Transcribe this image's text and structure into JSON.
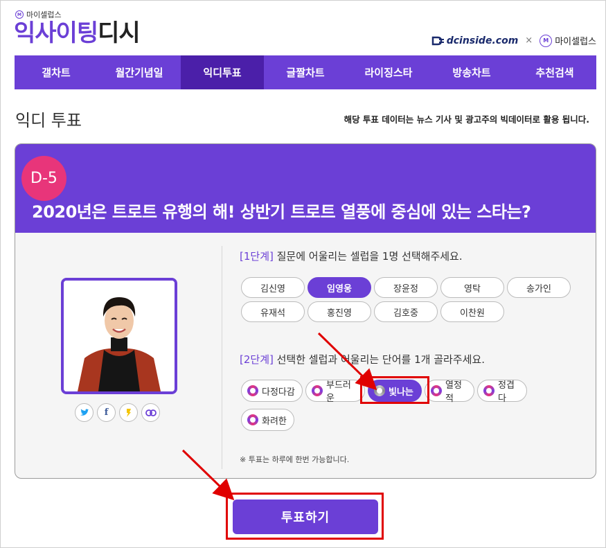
{
  "brand": {
    "small_label": "마이셀럽스",
    "title_part1": "익사이팅",
    "title_part2": "디시"
  },
  "partner": {
    "dc": "dcinside.com",
    "times": "×",
    "ms": "마이셀럽스"
  },
  "nav": {
    "items": [
      {
        "label": "갤차트"
      },
      {
        "label": "월간기념일"
      },
      {
        "label": "익디투표"
      },
      {
        "label": "글짤차트"
      },
      {
        "label": "라이징스타"
      },
      {
        "label": "방송차트"
      },
      {
        "label": "추천검색"
      }
    ],
    "active": "익디투표"
  },
  "page": {
    "title": "익디 투표",
    "note": "해당 투표 데이터는 뉴스 기사 및 광고주의 빅데이터로 활용 됩니다."
  },
  "poll": {
    "dday": "D-5",
    "question": "2020년은 트로트 유행의 해! 상반기 트로트 열풍에 중심에 있는 스타는?",
    "step1_tag": "[1단계]",
    "step1_text": " 질문에 어울리는 셀럽을 1명 선택해주세요.",
    "celebs": [
      "김신영",
      "임영웅",
      "장윤정",
      "영탁",
      "송가인",
      "유재석",
      "홍진영",
      "김호중",
      "이찬원"
    ],
    "selected_celeb": "임영웅",
    "step2_tag": "[2단계]",
    "step2_text": " 선택한 셀럽과 어울리는 단어를 1개 골라주세요.",
    "words": [
      "다정다감",
      "부드러운",
      "빛나는",
      "열정적",
      "정겹다",
      "화려한"
    ],
    "selected_word": "빛나는",
    "note": "※ 투표는 하루에 한번 가능합니다.",
    "vote_label": "투표하기"
  },
  "colors": {
    "accent": "#6b3fd6",
    "accent_dark": "#4b1fa9",
    "dday": "#e8357a",
    "highlight": "#e00000"
  }
}
